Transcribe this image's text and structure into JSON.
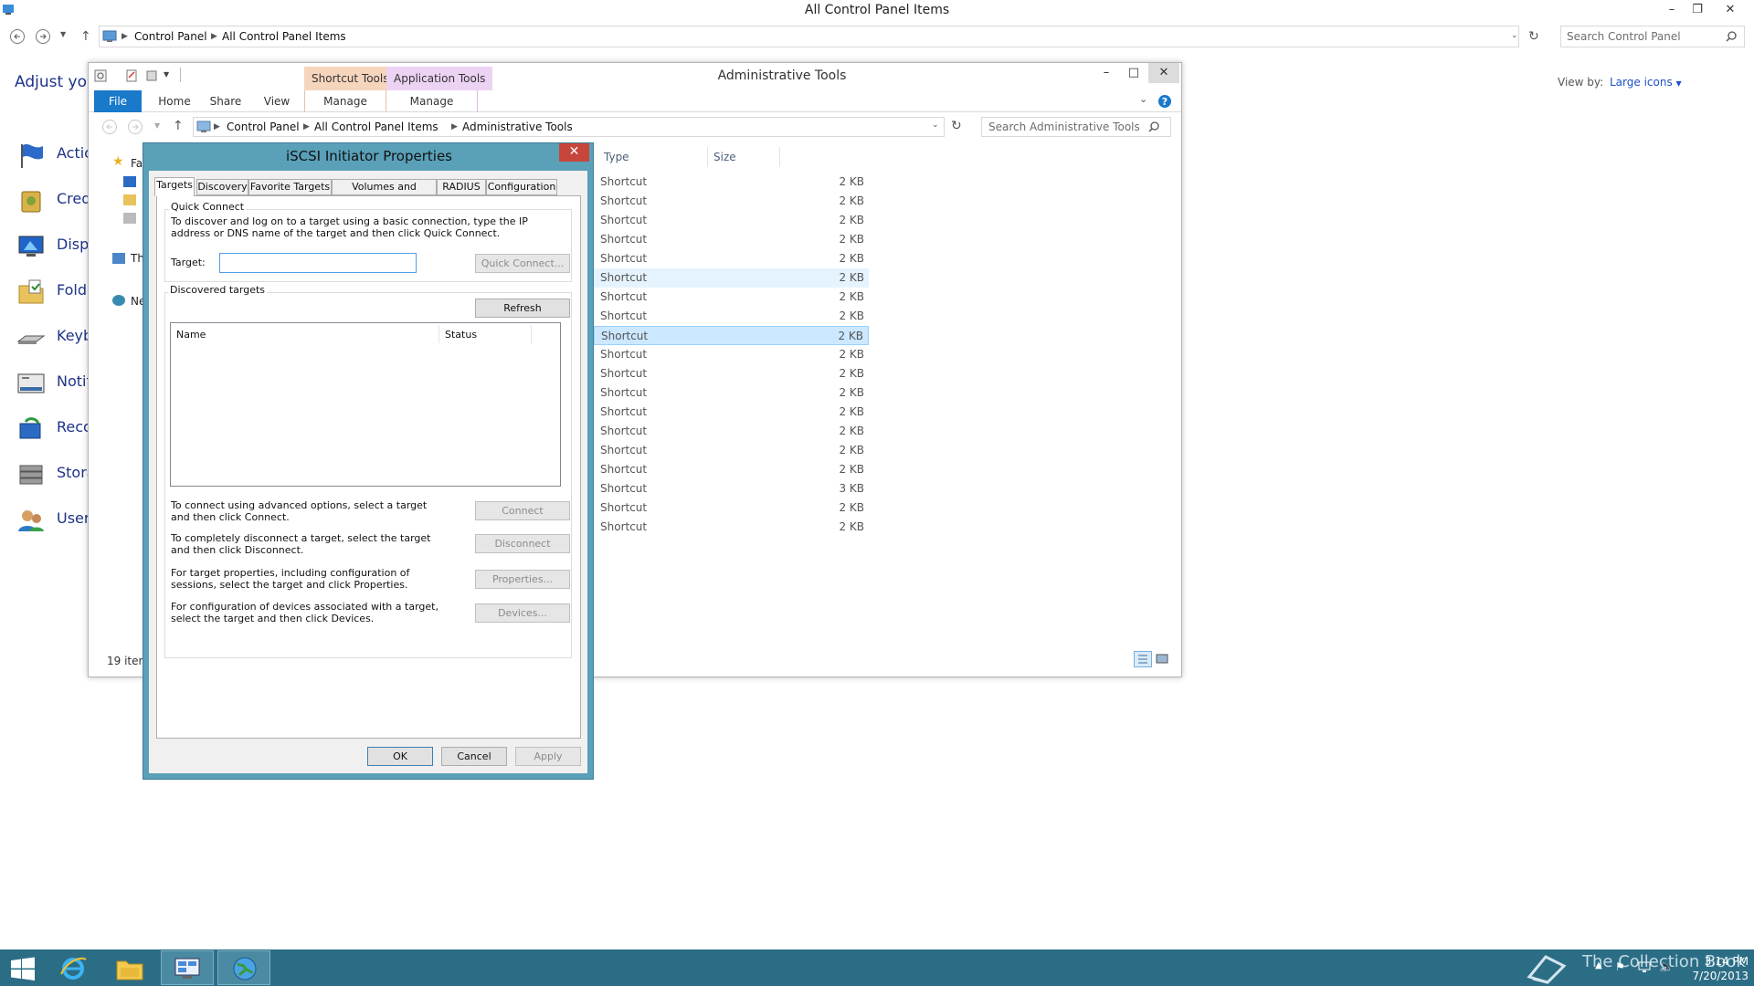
{
  "control_panel": {
    "title": "All Control Panel Items",
    "breadcrumb": [
      "Control Panel",
      "All Control Panel Items"
    ],
    "search_placeholder": "Search Control Panel",
    "heading": "Adjust your",
    "view_by_label": "View by:",
    "view_by_value": "Large icons",
    "items": [
      {
        "label": "Actic",
        "icon": "action-center-flag-icon"
      },
      {
        "label": "Cred",
        "icon": "credential-manager-icon"
      },
      {
        "label": "Displ",
        "icon": "display-icon"
      },
      {
        "label": "Folde",
        "icon": "folder-options-icon"
      },
      {
        "label": "Keyb",
        "icon": "keyboard-icon"
      },
      {
        "label": "Notifi",
        "icon": "notification-area-icon"
      },
      {
        "label": "Reco",
        "icon": "recovery-icon"
      },
      {
        "label": "Stora",
        "icon": "storage-spaces-icon"
      },
      {
        "label": "User",
        "icon": "user-accounts-icon"
      }
    ]
  },
  "admin_tools": {
    "title": "Administrative Tools",
    "context_tabs": [
      {
        "label": "Shortcut Tools",
        "color": "#f6d5bd"
      },
      {
        "label": "Application Tools",
        "color": "#ecd3f4"
      }
    ],
    "ribbon_tabs": [
      "File",
      "Home",
      "Share",
      "View",
      "Manage",
      "Manage"
    ],
    "breadcrumb": [
      "Control Panel",
      "All Control Panel Items",
      "Administrative Tools"
    ],
    "search_placeholder": "Search Administrative Tools",
    "nav_partial": [
      "Fa",
      "Th",
      "Ne"
    ],
    "columns": {
      "type": "Type",
      "size": "Size"
    },
    "rows": [
      {
        "type": "Shortcut",
        "size": "2 KB"
      },
      {
        "type": "Shortcut",
        "size": "2 KB"
      },
      {
        "type": "Shortcut",
        "size": "2 KB"
      },
      {
        "type": "Shortcut",
        "size": "2 KB"
      },
      {
        "type": "Shortcut",
        "size": "2 KB"
      },
      {
        "type": "Shortcut",
        "size": "2 KB"
      },
      {
        "type": "Shortcut",
        "size": "2 KB"
      },
      {
        "type": "Shortcut",
        "size": "2 KB"
      },
      {
        "type": "Shortcut",
        "size": "2 KB"
      },
      {
        "type": "Shortcut",
        "size": "2 KB"
      },
      {
        "type": "Shortcut",
        "size": "2 KB"
      },
      {
        "type": "Shortcut",
        "size": "2 KB"
      },
      {
        "type": "Shortcut",
        "size": "2 KB"
      },
      {
        "type": "Shortcut",
        "size": "2 KB"
      },
      {
        "type": "Shortcut",
        "size": "2 KB"
      },
      {
        "type": "Shortcut",
        "size": "2 KB"
      },
      {
        "type": "Shortcut",
        "size": "3 KB"
      },
      {
        "type": "Shortcut",
        "size": "2 KB"
      },
      {
        "type": "Shortcut",
        "size": "2 KB"
      }
    ],
    "status": "19 item"
  },
  "dialog": {
    "title": "iSCSI Initiator Properties",
    "tabs": [
      "Targets",
      "Discovery",
      "Favorite Targets",
      "Volumes and Devices",
      "RADIUS",
      "Configuration"
    ],
    "quick_connect": {
      "group_label": "Quick Connect",
      "description": "To discover and log on to a target using a basic connection, type the IP address or DNS name of the target and then click Quick Connect.",
      "target_label": "Target:",
      "target_value": "",
      "button": "Quick Connect..."
    },
    "discovered": {
      "group_label": "Discovered targets",
      "refresh": "Refresh",
      "col_name": "Name",
      "col_status": "Status"
    },
    "actions": [
      {
        "text": "To connect using advanced options, select a target and then click Connect.",
        "button": "Connect"
      },
      {
        "text": "To completely disconnect a target, select the target and then click Disconnect.",
        "button": "Disconnect"
      },
      {
        "text": "For target properties, including configuration of sessions, select the target and click Properties.",
        "button": "Properties..."
      },
      {
        "text": "For configuration of devices associated with a target, select the target and then click Devices.",
        "button": "Devices..."
      }
    ],
    "ok": "OK",
    "cancel": "Cancel",
    "apply": "Apply"
  },
  "taskbar": {
    "watermark": "The Collection Book",
    "time": "3:14 PM",
    "date": "7/20/2013"
  }
}
